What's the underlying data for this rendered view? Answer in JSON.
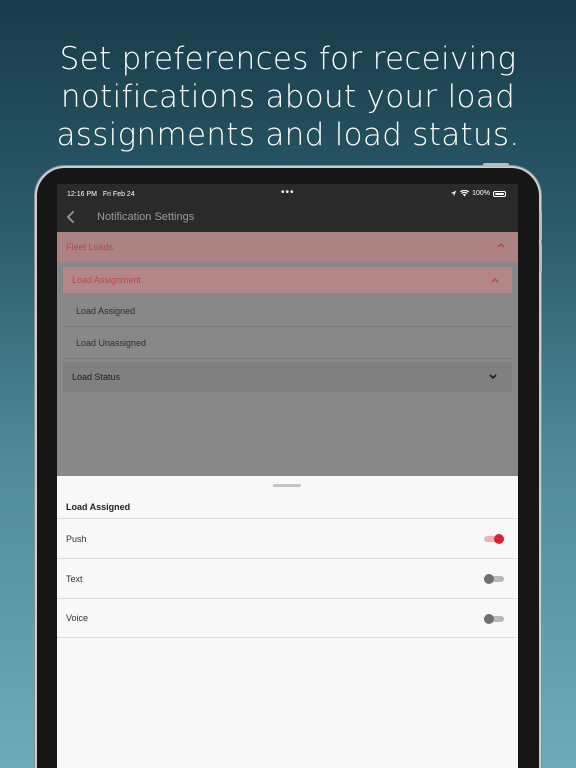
{
  "headline": {
    "line1": "Set preferences for receiving",
    "line2": "notifications about your load",
    "line3": "assignments and load status."
  },
  "status_bar": {
    "time": "12:16 PM",
    "date": "Fri Feb 24",
    "dots": "•••",
    "battery": "100%"
  },
  "navbar": {
    "title": "Notification Settings"
  },
  "sections": {
    "fleet_loads": "Fleet Loads",
    "load_assignment": "Load Assignment",
    "items": [
      "Load Assigned",
      "Load Unassigned"
    ],
    "load_status": "Load Status"
  },
  "sheet": {
    "title": "Load Assigned",
    "options": [
      {
        "label": "Push",
        "enabled": true
      },
      {
        "label": "Text",
        "enabled": false
      },
      {
        "label": "Voice",
        "enabled": false
      }
    ]
  },
  "colors": {
    "accent": "#d8222d",
    "header_text": "#b44a4c"
  }
}
